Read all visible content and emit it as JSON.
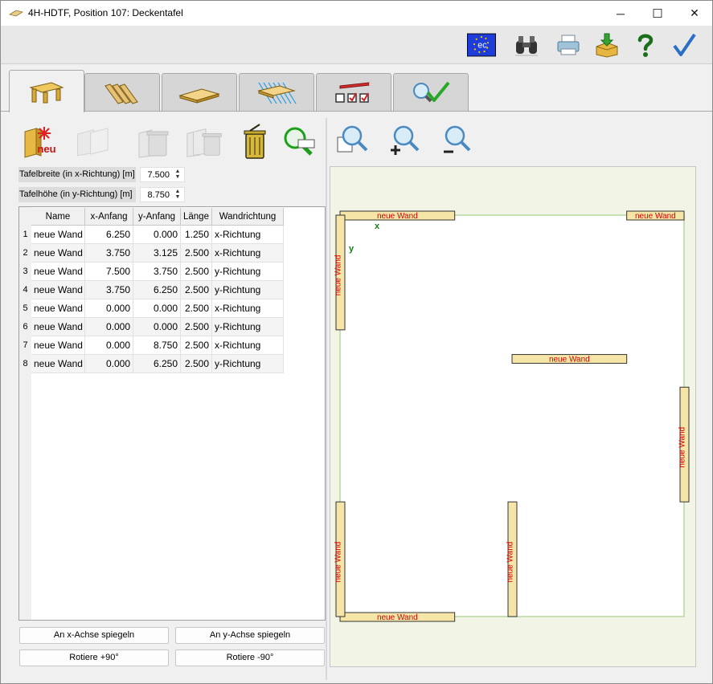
{
  "window": {
    "title": "4H-HDTF, Position 107: Deckentafel",
    "minimize": "─",
    "maximize": "☐",
    "close": "✕"
  },
  "toolbar": {
    "icons": [
      "eu-flag-icon",
      "binoculars-icon",
      "printer-icon",
      "download-box-icon",
      "help-icon",
      "checkmark-icon"
    ],
    "eu_text": "ec"
  },
  "tabs": [
    "wall-tab",
    "beams-tab",
    "boards-tab",
    "layers-tab",
    "checklist-tab",
    "check-zoom-tab"
  ],
  "left_tools": [
    "new-wall-icon",
    "copy-wall-icon",
    "delete-wall-icon",
    "delete-all-icon",
    "trash-icon",
    "zoom-select-icon"
  ],
  "new_label": "neu",
  "params": {
    "width_label": "Tafelbreite (in x-Richtung) [m]",
    "width_value": "7.500",
    "height_label": "Tafelhöhe (in y-Richtung) [m]",
    "height_value": "8.750"
  },
  "table": {
    "headers": [
      "Name",
      "x-Anfang",
      "y-Anfang",
      "Länge",
      "Wandrichtung"
    ],
    "rows": [
      {
        "n": "1",
        "name": "neue Wand",
        "x": "6.250",
        "y": "0.000",
        "l": "1.250",
        "dir": "x-Richtung"
      },
      {
        "n": "2",
        "name": "neue Wand",
        "x": "3.750",
        "y": "3.125",
        "l": "2.500",
        "dir": "x-Richtung"
      },
      {
        "n": "3",
        "name": "neue Wand",
        "x": "7.500",
        "y": "3.750",
        "l": "2.500",
        "dir": "y-Richtung"
      },
      {
        "n": "4",
        "name": "neue Wand",
        "x": "3.750",
        "y": "6.250",
        "l": "2.500",
        "dir": "y-Richtung"
      },
      {
        "n": "5",
        "name": "neue Wand",
        "x": "0.000",
        "y": "0.000",
        "l": "2.500",
        "dir": "x-Richtung"
      },
      {
        "n": "6",
        "name": "neue Wand",
        "x": "0.000",
        "y": "0.000",
        "l": "2.500",
        "dir": "y-Richtung"
      },
      {
        "n": "7",
        "name": "neue Wand",
        "x": "0.000",
        "y": "8.750",
        "l": "2.500",
        "dir": "x-Richtung"
      },
      {
        "n": "8",
        "name": "neue Wand",
        "x": "0.000",
        "y": "6.250",
        "l": "2.500",
        "dir": "y-Richtung"
      }
    ]
  },
  "buttons": {
    "mirror_x": "An x-Achse spiegeln",
    "mirror_y": "An y-Achse spiegeln",
    "rotate_plus": "Rotiere +90°",
    "rotate_minus": "Rotiere -90°"
  },
  "right_tools": [
    "zoom-fit-icon",
    "zoom-in-icon",
    "zoom-out-icon"
  ],
  "canvas": {
    "axis_x": "x",
    "axis_y": "y",
    "wall_label": "neue Wand",
    "panel_width_m": 7.5,
    "panel_height_m": 8.75,
    "colors": {
      "wall_fill": "#f5e6a8",
      "wall_stroke": "#333333",
      "label": "#d40000",
      "axis": "#1a7a1a",
      "panel_border": "#b8d8a0"
    }
  }
}
